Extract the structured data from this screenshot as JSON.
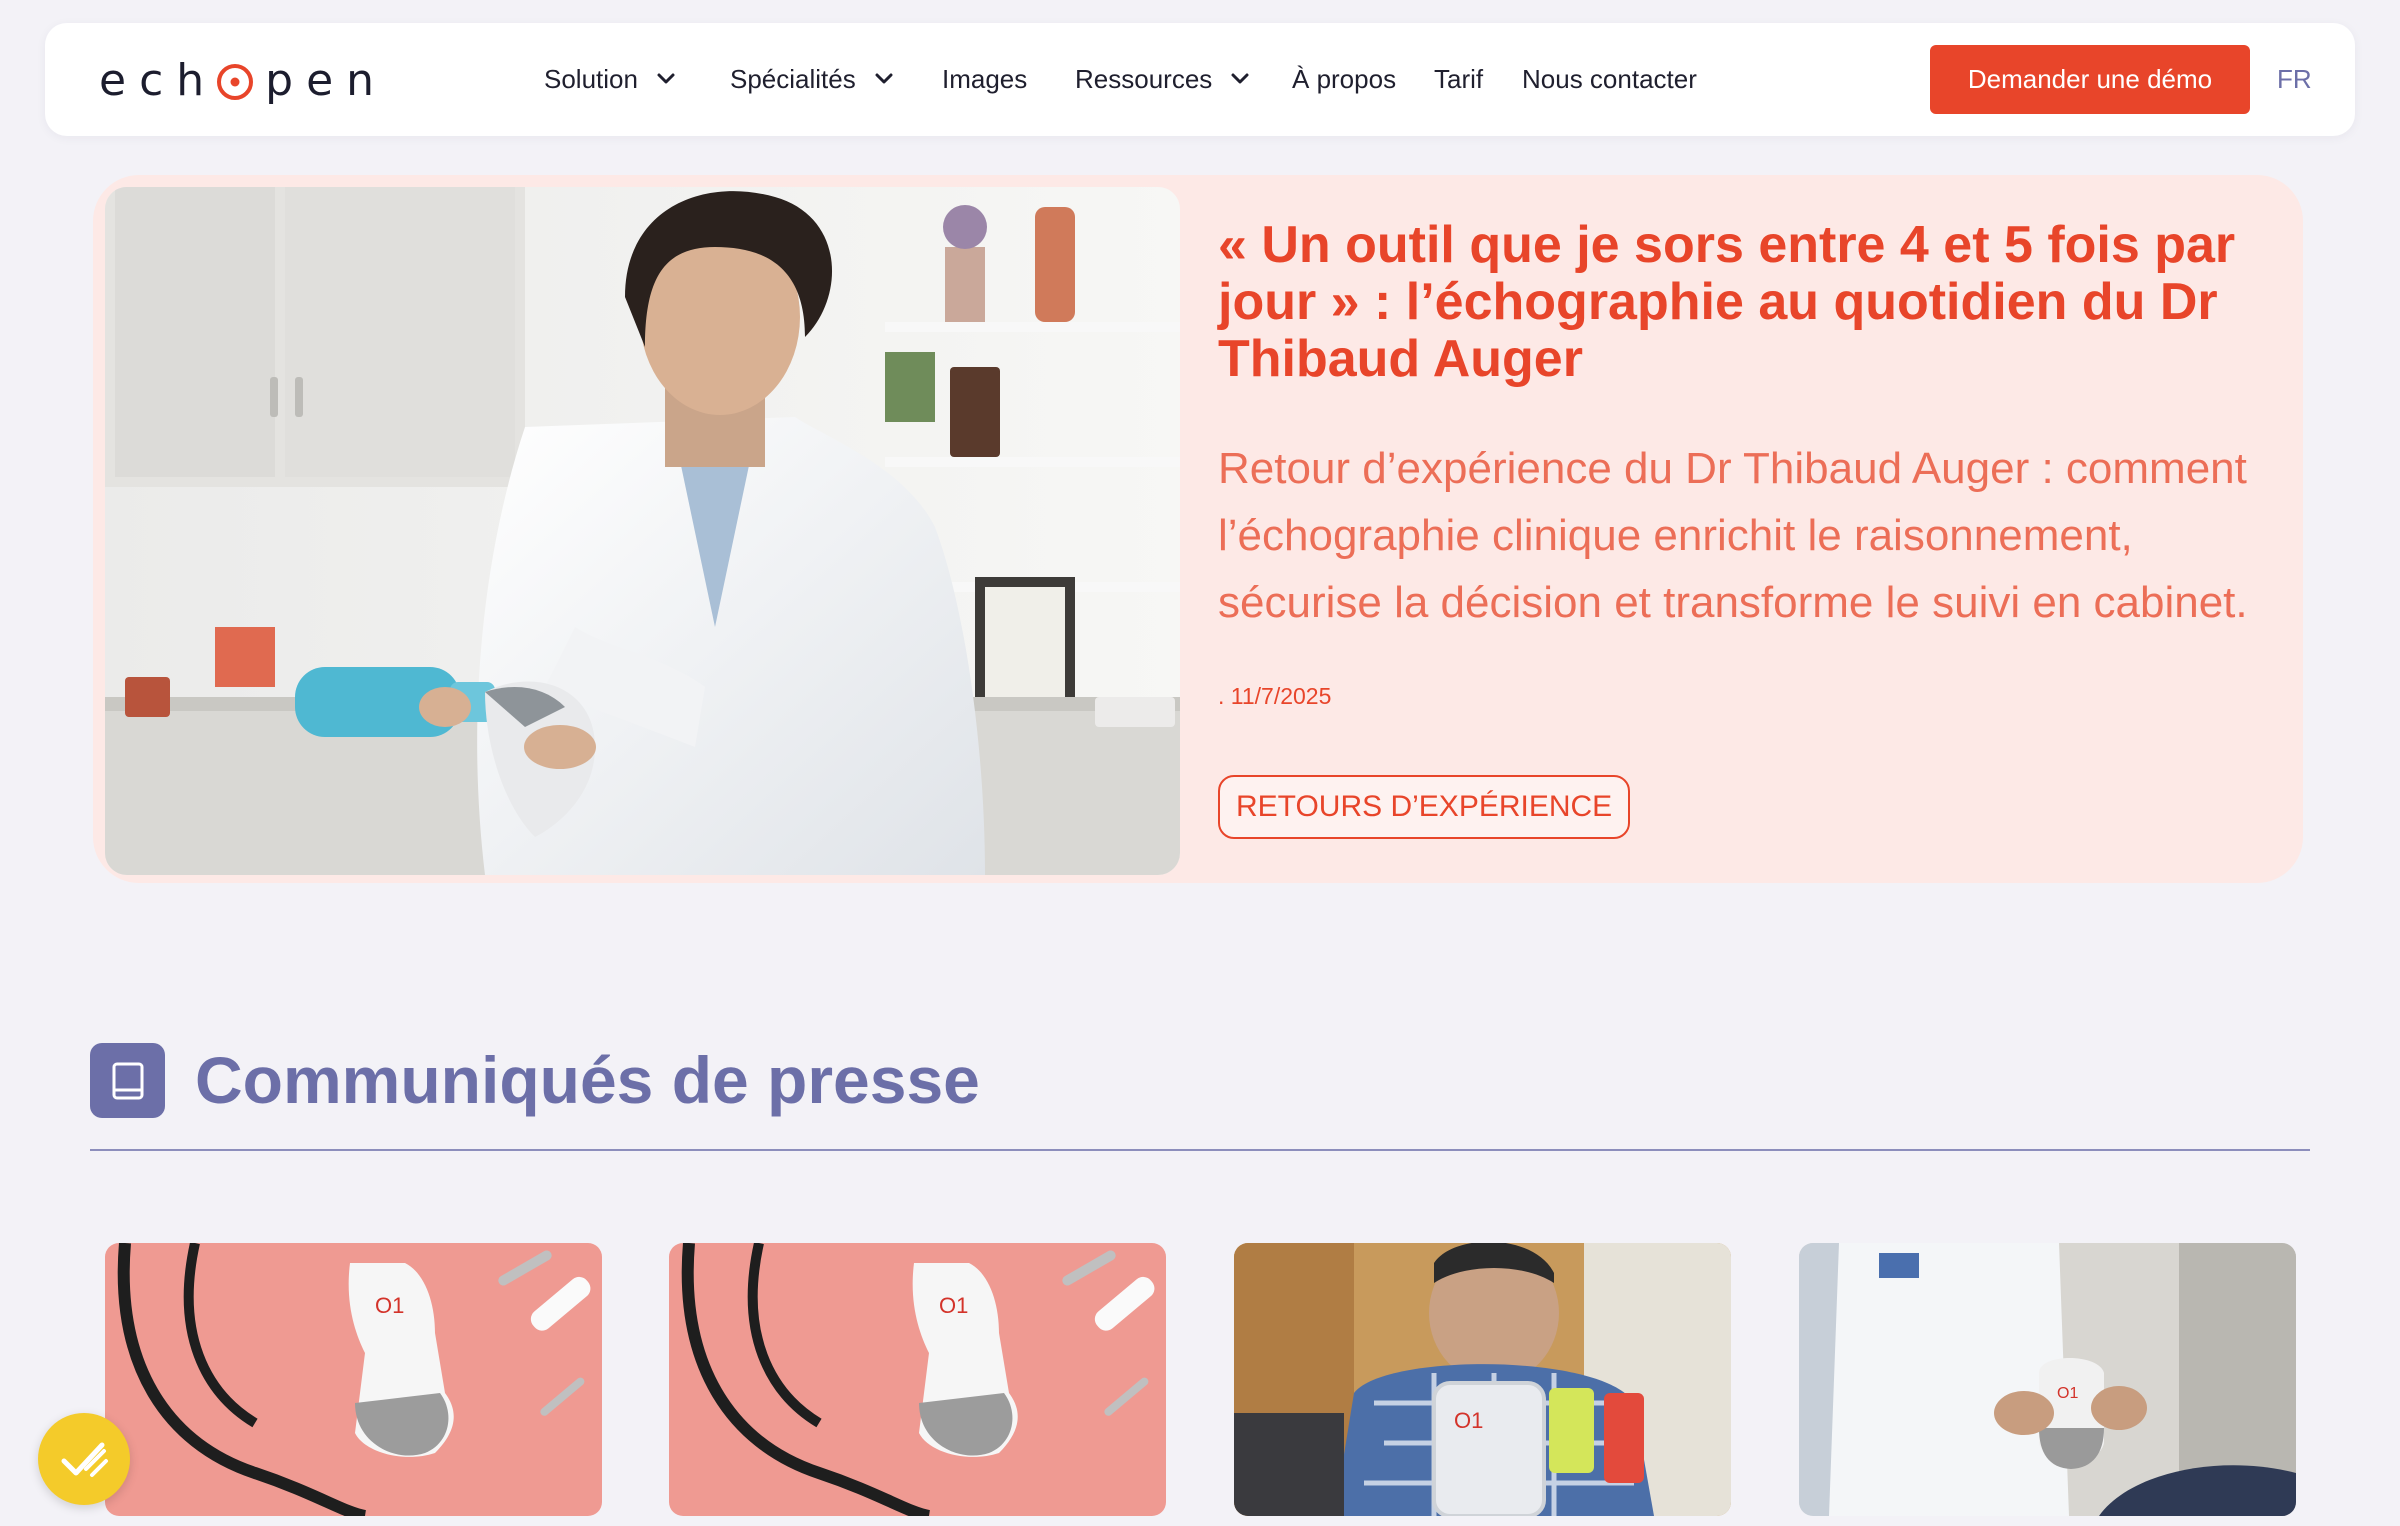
{
  "nav": {
    "logo": {
      "prefix": "ech",
      "suffix": "pen"
    },
    "menu": [
      {
        "label": "Solution",
        "dropdown": true
      },
      {
        "label": "Spécialités",
        "dropdown": true
      },
      {
        "label": "Images",
        "dropdown": false
      },
      {
        "label": "Ressources",
        "dropdown": true
      },
      {
        "label": "À propos",
        "dropdown": false
      },
      {
        "label": "Tarif",
        "dropdown": false
      },
      {
        "label": "Nous contacter",
        "dropdown": false
      }
    ],
    "cta_label": "Demander une démo",
    "lang": "FR"
  },
  "hero": {
    "title": "« Un outil que je sors entre 4 et 5 fois par jour » : l’échographie au quotidien du Dr Thibaud Auger",
    "subtitle": "Retour d’expérience du Dr Thibaud Auger : comment l’échographie clinique enrichit le raisonnement, sécurise la décision et transforme le suivi en cabinet.",
    "date": ". 11/7/2025",
    "tag": "RETOURS D’EXPÉRIENCE"
  },
  "section": {
    "title": "Communiqués de presse",
    "icon": "book-icon"
  },
  "cards": [
    {
      "image": "probe-stethoscope-pink"
    },
    {
      "image": "probe-stethoscope-pink"
    },
    {
      "image": "engineer-with-probe"
    },
    {
      "image": "doctor-holding-probe"
    }
  ],
  "colors": {
    "accent": "#e8452a",
    "brand_purple": "#6c6fa8",
    "hero_bg": "#fde9e6",
    "page_bg": "#f3f2f7",
    "badge": "#f4cb2a"
  }
}
